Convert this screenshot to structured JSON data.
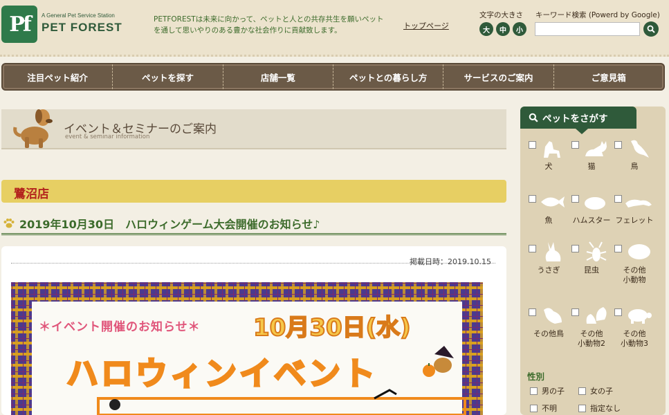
{
  "header": {
    "logo_mark": "Pf",
    "logo_tagline": "A General Pet Service Station",
    "logo_name": "PET FOREST",
    "tagline": "PETFORESTは未来に向かって、ペットと人との共存共生を願いペットを通して思いやりのある豊かな社会作りに貢献致します。",
    "top_link": "トップページ",
    "font_size_label": "文字の大きさ",
    "font_sizes": [
      "大",
      "中",
      "小"
    ],
    "search_label": "キーワード検索 (Powerd by Google)",
    "search_placeholder": ""
  },
  "nav": {
    "items": [
      "注目ペット紹介",
      "ペットを探す",
      "店舗一覧",
      "ペットとの暮らし方",
      "サービスのご案内",
      "ご意見箱"
    ]
  },
  "page_heading": {
    "title": "イベント＆セミナーのご案内",
    "subtitle": "event & seminar information"
  },
  "store": {
    "name": "鷺沼店"
  },
  "article": {
    "title": "2019年10月30日　ハロウィンゲーム大会開催のお知らせ♪",
    "posted_date": "掲載日時：2019.10.15"
  },
  "event_image": {
    "notice": "＊イベント開催のお知らせ＊",
    "date": "10月30日(水)",
    "headline": "ハロウィンイベント"
  },
  "sidebar": {
    "tab_label": "ペットをさがす",
    "pets": [
      {
        "label": "犬",
        "icon": "dog-icon"
      },
      {
        "label": "猫",
        "icon": "cat-icon"
      },
      {
        "label": "鳥",
        "icon": "bird-icon"
      },
      {
        "label": "魚",
        "icon": "fish-icon"
      },
      {
        "label": "ハムスター",
        "icon": "hamster-icon"
      },
      {
        "label": "フェレット",
        "icon": "ferret-icon"
      },
      {
        "label": "うさぎ",
        "icon": "rabbit-icon"
      },
      {
        "label": "昆虫",
        "icon": "insect-icon"
      },
      {
        "label": "その他\n小動物",
        "icon": "small-animal-icon"
      },
      {
        "label": "その他鳥",
        "icon": "other-bird-icon"
      },
      {
        "label": "その他\n小動物2",
        "icon": "squirrel-icon"
      },
      {
        "label": "その他\n小動物3",
        "icon": "turtle-icon"
      }
    ],
    "gender_title": "性別",
    "gender_options": [
      "男の子",
      "女の子",
      "不明",
      "指定なし"
    ]
  },
  "colors": {
    "nav_bg": "#6b5a47",
    "brand_green": "#2f5a3a",
    "store_band": "#e7cf63",
    "store_text": "#b3241d"
  }
}
